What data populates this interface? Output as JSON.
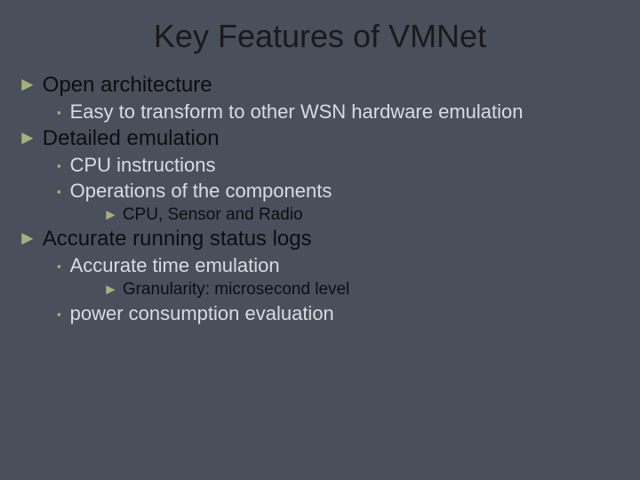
{
  "title": "Key Features of VMNet",
  "b1": {
    "text": "Open architecture"
  },
  "b1s1": {
    "text": "Easy to transform to other WSN hardware emulation"
  },
  "b2": {
    "text": "Detailed emulation"
  },
  "b2s1": {
    "text": "CPU instructions"
  },
  "b2s2": {
    "text": "Operations of the components"
  },
  "b2s2a": {
    "text": "CPU, Sensor and Radio"
  },
  "b3": {
    "text": "Accurate running status logs"
  },
  "b3s1": {
    "text": "Accurate time emulation"
  },
  "b3s1a": {
    "text": "Granularity: microsecond level"
  },
  "b3s2": {
    "text": "power consumption evaluation"
  }
}
